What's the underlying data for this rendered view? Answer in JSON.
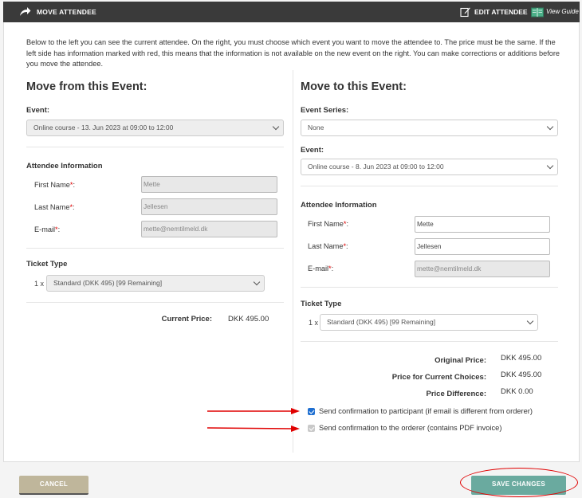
{
  "header": {
    "title": "MOVE ATTENDEE",
    "edit_label": "EDIT ATTENDEE",
    "guide_label": "View Guide"
  },
  "intro": "Below to the left you can see the current attendee. On the right, you must choose which event you want to move the attendee to. The price must be the same. If the left side has information marked with red, this means that the information is not available on the new event on the right. You can make corrections or additions before you move the attendee.",
  "left": {
    "heading": "Move from this Event:",
    "event_label": "Event:",
    "event_value": "Online course - 13. Jun 2023 at 09:00 to 12:00",
    "attendee_heading": "Attendee Information",
    "first_name_label": "First Name",
    "first_name_value": "Mette",
    "last_name_label": "Last Name",
    "last_name_value": "Jellesen",
    "email_label": "E-mail",
    "email_value": "mette@nemtilmeld.dk",
    "ticket_heading": "Ticket Type",
    "qty": "1 x",
    "ticket_value": "Standard (DKK 495) [99 Remaining]",
    "current_price_label": "Current Price:",
    "current_price_value": "DKK 495.00"
  },
  "right": {
    "heading": "Move to this Event:",
    "series_label": "Event Series:",
    "series_value": "None",
    "event_label": "Event:",
    "event_value": "Online course - 8. Jun 2023 at 09:00 to 12:00",
    "attendee_heading": "Attendee Information",
    "first_name_label": "First Name",
    "first_name_value": "Mette",
    "last_name_label": "Last Name",
    "last_name_value": "Jellesen",
    "email_label": "E-mail",
    "email_value": "mette@nemtilmeld.dk",
    "ticket_heading": "Ticket Type",
    "qty": "1 x",
    "ticket_value": "Standard (DKK 495) [99 Remaining]",
    "original_price_label": "Original Price:",
    "original_price_value": "DKK 495.00",
    "current_choices_label": "Price for Current Choices:",
    "current_choices_value": "DKK 495.00",
    "difference_label": "Price Difference:",
    "difference_value": "DKK 0.00",
    "confirm_participant": "Send confirmation to participant (if email is different from orderer)",
    "confirm_orderer": "Send confirmation to the orderer (contains PDF invoice)"
  },
  "footer": {
    "cancel": "CANCEL",
    "save": "SAVE CHANGES"
  },
  "required_mark": "*",
  "colors": {
    "header_bg": "#3a3a3a",
    "save_button": "#6aaa9f",
    "cancel_button": "#bfb69b",
    "annotation_red": "#e00000",
    "checkbox_blue": "#1f6fd1"
  }
}
